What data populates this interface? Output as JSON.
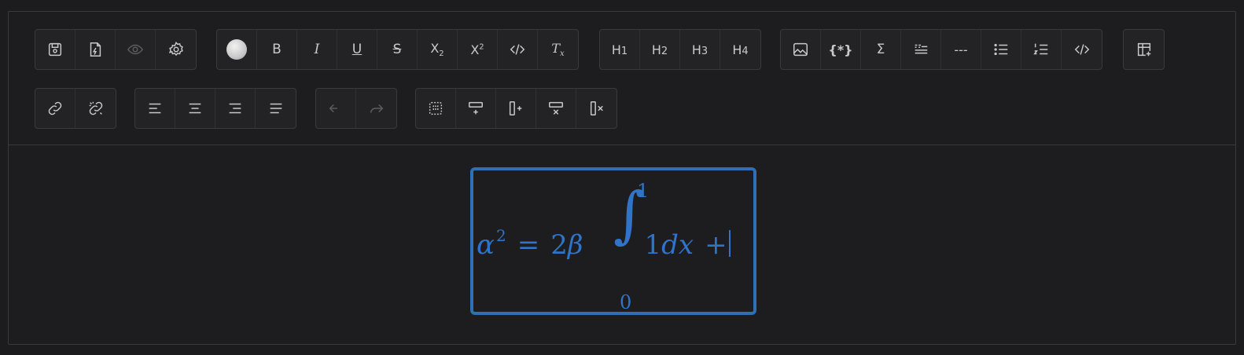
{
  "toolbar": {
    "group_file": [
      "save-icon",
      "export-file-icon",
      "eye-icon",
      "gear-icon"
    ],
    "group_format": {
      "bold": "B",
      "italic": "I",
      "underline": "U",
      "strikethrough": "S",
      "subscript_base": "X",
      "subscript_mark": "2",
      "superscript_base": "X",
      "superscript_mark": "2",
      "clear_base": "T",
      "clear_mark": "x"
    },
    "group_heading": {
      "h1": "H",
      "h1_n": "1",
      "h2": "H",
      "h2_n": "2",
      "h3": "H",
      "h3_n": "3",
      "h4": "H",
      "h4_n": "4"
    },
    "group_insert": {
      "math_block": "{*}",
      "sum": "Σ",
      "divider": "---"
    },
    "accent_color": "#2f6fb5"
  },
  "math": {
    "alpha": "α",
    "exp": "2",
    "eq": "=",
    "coef": "2",
    "beta": "β",
    "upper": "1",
    "lower": "0",
    "integrand_num": "1",
    "d": "d",
    "x": "x",
    "plus": "+"
  }
}
